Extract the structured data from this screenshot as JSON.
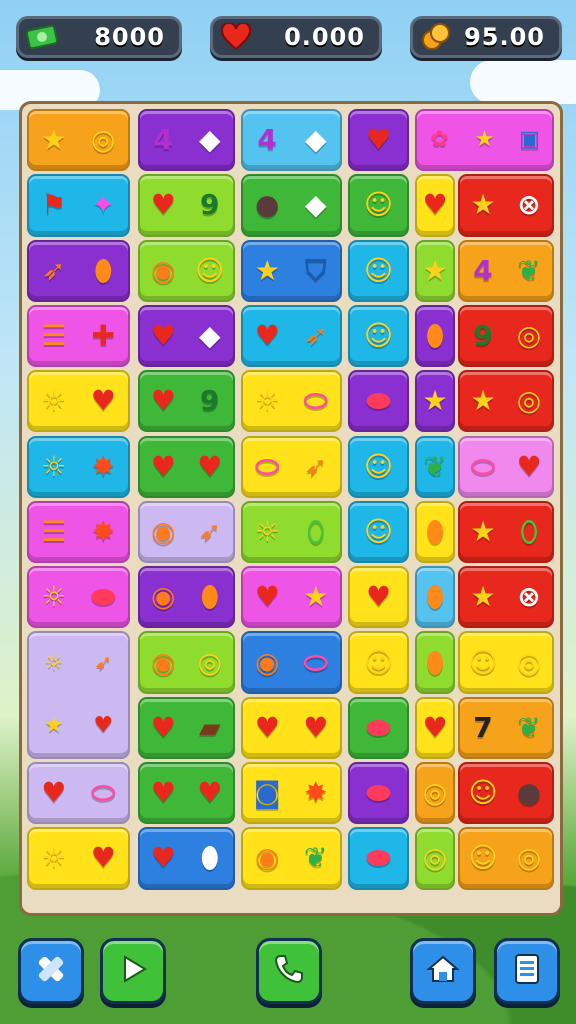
{
  "hud": {
    "cash": {
      "icon": "cash-icon",
      "value": "8000"
    },
    "lives": {
      "icon": "heart-icon",
      "value": "0.000"
    },
    "coins": {
      "icon": "coins-icon",
      "value": "95.00"
    }
  },
  "colors": {
    "orange": "#f7a21b",
    "purple": "#8a2fd0",
    "sky": "#55c3f0",
    "magenta": "#ee55e6",
    "cyan": "#1fb7e8",
    "lime": "#8fdc2f",
    "green": "#3fb83a",
    "yellow": "#ffe21a",
    "red": "#e8281c",
    "blue": "#2d7fe0",
    "lavender": "#cdb9f1",
    "pink": "#f088ee"
  },
  "tiles": [
    {
      "row": 0,
      "col": 0,
      "span": 1,
      "color": "orange",
      "icons": [
        "star-icon",
        "donut-icon"
      ]
    },
    {
      "row": 0,
      "col": 1,
      "span": 1,
      "color": "purple",
      "icons": [
        "number-four-icon",
        "diamond-icon"
      ]
    },
    {
      "row": 0,
      "col": 2,
      "span": 1,
      "color": "sky",
      "icons": [
        "number-four-icon",
        "diamond-icon"
      ]
    },
    {
      "row": 0,
      "col": 3,
      "span": 1,
      "color": "purple",
      "icons": [
        "heart-icon"
      ]
    },
    {
      "row": 0,
      "col": 4,
      "span": 1,
      "color": "magenta",
      "icons": [
        "strawberry-icon",
        "star-icon",
        "briefcase-icon"
      ]
    },
    {
      "row": 1,
      "col": 0,
      "span": 1,
      "color": "cyan",
      "icons": [
        "flag-icon",
        "sparkle-icon"
      ]
    },
    {
      "row": 1,
      "col": 1,
      "span": 1,
      "color": "lime",
      "icons": [
        "heart-icon",
        "number-nine-icon"
      ]
    },
    {
      "row": 1,
      "col": 2,
      "span": 1,
      "color": "green",
      "icons": [
        "bomb-icon",
        "diamond-icon"
      ]
    },
    {
      "row": 1,
      "col": 3,
      "span": 1,
      "color": "green",
      "icons": [
        "smiley-icon"
      ]
    },
    {
      "row": 1,
      "col": 4,
      "span": 1,
      "color": "yellow",
      "icons": [
        "heart-icon"
      ]
    },
    {
      "row": 1,
      "col": 5,
      "span": 1,
      "color": "red",
      "icons": [
        "star-icon",
        "racket-icon"
      ]
    },
    {
      "row": 2,
      "col": 0,
      "span": 1,
      "color": "purple",
      "icons": [
        "carrot-icon",
        "drop-icon"
      ]
    },
    {
      "row": 2,
      "col": 1,
      "span": 1,
      "color": "lime",
      "icons": [
        "lollipop-icon",
        "smiley-icon"
      ]
    },
    {
      "row": 2,
      "col": 2,
      "span": 1,
      "color": "blue",
      "icons": [
        "star-icon",
        "shield-icon"
      ]
    },
    {
      "row": 2,
      "col": 3,
      "span": 1,
      "color": "cyan",
      "icons": [
        "smiley-icon"
      ]
    },
    {
      "row": 2,
      "col": 4,
      "span": 1,
      "color": "lime",
      "icons": [
        "star-icon"
      ]
    },
    {
      "row": 2,
      "col": 5,
      "span": 1,
      "color": "orange",
      "icons": [
        "number-four-icon",
        "leaf-icon"
      ]
    },
    {
      "row": 3,
      "col": 0,
      "span": 1,
      "color": "magenta",
      "icons": [
        "burger-icon",
        "puzzle-icon"
      ]
    },
    {
      "row": 3,
      "col": 1,
      "span": 1,
      "color": "purple",
      "icons": [
        "heart-icon",
        "diamond-icon"
      ]
    },
    {
      "row": 3,
      "col": 2,
      "span": 1,
      "color": "cyan",
      "icons": [
        "heart-icon",
        "carrot-icon"
      ]
    },
    {
      "row": 3,
      "col": 3,
      "span": 1,
      "color": "cyan",
      "icons": [
        "smiley-icon"
      ]
    },
    {
      "row": 3,
      "col": 4,
      "span": 1,
      "color": "purple",
      "icons": [
        "drop-icon"
      ]
    },
    {
      "row": 3,
      "col": 5,
      "span": 1,
      "color": "red",
      "icons": [
        "number-nine-icon",
        "donut-icon"
      ]
    },
    {
      "row": 4,
      "col": 0,
      "span": 1,
      "color": "yellow",
      "icons": [
        "sun-icon",
        "heart-icon"
      ]
    },
    {
      "row": 4,
      "col": 1,
      "span": 1,
      "color": "green",
      "icons": [
        "heart-icon",
        "number-nine-icon"
      ]
    },
    {
      "row": 4,
      "col": 2,
      "span": 1,
      "color": "yellow",
      "icons": [
        "sun-icon",
        "candy-icon"
      ]
    },
    {
      "row": 4,
      "col": 3,
      "span": 1,
      "color": "purple",
      "icons": [
        "bean-icon"
      ]
    },
    {
      "row": 4,
      "col": 4,
      "span": 1,
      "color": "purple",
      "icons": [
        "star-icon"
      ]
    },
    {
      "row": 4,
      "col": 5,
      "span": 1,
      "color": "red",
      "icons": [
        "star-icon",
        "donut-icon"
      ]
    },
    {
      "row": 5,
      "col": 0,
      "span": 1,
      "color": "cyan",
      "icons": [
        "sun-icon",
        "splat-icon"
      ]
    },
    {
      "row": 5,
      "col": 1,
      "span": 1,
      "color": "green",
      "icons": [
        "heart-icon",
        "heart-icon"
      ]
    },
    {
      "row": 5,
      "col": 2,
      "span": 1,
      "color": "yellow",
      "icons": [
        "candy-icon",
        "carrot-icon"
      ]
    },
    {
      "row": 5,
      "col": 3,
      "span": 1,
      "color": "cyan",
      "icons": [
        "smiley-icon"
      ]
    },
    {
      "row": 5,
      "col": 4,
      "span": 1,
      "color": "cyan",
      "icons": [
        "leaf-icon"
      ]
    },
    {
      "row": 5,
      "col": 5,
      "span": 1,
      "color": "pink",
      "icons": [
        "candy-icon",
        "heart-icon"
      ]
    },
    {
      "row": 6,
      "col": 0,
      "span": 1,
      "color": "magenta",
      "icons": [
        "burger-icon",
        "splat-icon"
      ]
    },
    {
      "row": 6,
      "col": 1,
      "span": 1,
      "color": "lavender",
      "icons": [
        "lollipop-icon",
        "carrot-icon"
      ]
    },
    {
      "row": 6,
      "col": 2,
      "span": 1,
      "color": "lime",
      "icons": [
        "sun-icon",
        "pickle-icon"
      ]
    },
    {
      "row": 6,
      "col": 3,
      "span": 1,
      "color": "cyan",
      "icons": [
        "smiley-icon"
      ]
    },
    {
      "row": 6,
      "col": 4,
      "span": 1,
      "color": "yellow",
      "icons": [
        "drop-icon"
      ]
    },
    {
      "row": 6,
      "col": 5,
      "span": 1,
      "color": "red",
      "icons": [
        "star-icon",
        "pickle-icon"
      ]
    },
    {
      "row": 7,
      "col": 0,
      "span": 1,
      "color": "magenta",
      "icons": [
        "sun-icon",
        "bean-icon"
      ]
    },
    {
      "row": 7,
      "col": 1,
      "span": 1,
      "color": "purple",
      "icons": [
        "lollipop-icon",
        "drop-icon"
      ]
    },
    {
      "row": 7,
      "col": 2,
      "span": 1,
      "color": "magenta",
      "icons": [
        "heart-icon",
        "star-icon"
      ]
    },
    {
      "row": 7,
      "col": 3,
      "span": 1,
      "color": "yellow",
      "icons": [
        "heart-icon"
      ]
    },
    {
      "row": 7,
      "col": 4,
      "span": 1,
      "color": "sky",
      "icons": [
        "drop-icon"
      ]
    },
    {
      "row": 7,
      "col": 5,
      "span": 1,
      "color": "red",
      "icons": [
        "star-icon",
        "racket-icon"
      ]
    },
    {
      "row": 8,
      "col": 0,
      "span": 2,
      "color": "lavender",
      "icons": [
        "sun-icon",
        "carrot-icon",
        "star-icon",
        "heart-icon"
      ]
    },
    {
      "row": 8,
      "col": 1,
      "span": 1,
      "color": "lime",
      "icons": [
        "lollipop-icon",
        "donut-icon"
      ]
    },
    {
      "row": 8,
      "col": 2,
      "span": 1,
      "color": "blue",
      "icons": [
        "lollipop-icon",
        "candy-icon"
      ]
    },
    {
      "row": 8,
      "col": 3,
      "span": 1,
      "color": "yellow",
      "icons": [
        "smiley-icon"
      ]
    },
    {
      "row": 8,
      "col": 4,
      "span": 1,
      "color": "lime",
      "icons": [
        "drop-icon"
      ]
    },
    {
      "row": 8,
      "col": 5,
      "span": 1,
      "color": "yellow",
      "icons": [
        "smiley-icon",
        "donut-icon"
      ]
    },
    {
      "row": 9,
      "col": 1,
      "span": 1,
      "color": "green",
      "icons": [
        "heart-icon",
        "chocolate-icon"
      ]
    },
    {
      "row": 9,
      "col": 2,
      "span": 1,
      "color": "yellow",
      "icons": [
        "heart-icon",
        "heart-icon"
      ]
    },
    {
      "row": 9,
      "col": 3,
      "span": 1,
      "color": "green",
      "icons": [
        "bean-icon"
      ]
    },
    {
      "row": 9,
      "col": 4,
      "span": 1,
      "color": "yellow",
      "icons": [
        "heart-icon"
      ]
    },
    {
      "row": 9,
      "col": 5,
      "span": 1,
      "color": "orange",
      "icons": [
        "number-seven-icon",
        "leaf-icon"
      ]
    },
    {
      "row": 10,
      "col": 0,
      "span": 1,
      "color": "lavender",
      "icons": [
        "heart-icon",
        "candy-icon"
      ]
    },
    {
      "row": 10,
      "col": 1,
      "span": 1,
      "color": "green",
      "icons": [
        "heart-icon",
        "heart-icon"
      ]
    },
    {
      "row": 10,
      "col": 2,
      "span": 1,
      "color": "yellow",
      "icons": [
        "jar-icon",
        "splat-icon"
      ]
    },
    {
      "row": 10,
      "col": 3,
      "span": 1,
      "color": "purple",
      "icons": [
        "bean-icon"
      ]
    },
    {
      "row": 10,
      "col": 4,
      "span": 1,
      "color": "orange",
      "icons": [
        "donut-icon"
      ]
    },
    {
      "row": 10,
      "col": 5,
      "span": 1,
      "color": "red",
      "icons": [
        "smiley-icon",
        "bomb-icon"
      ]
    },
    {
      "row": 11,
      "col": 0,
      "span": 1,
      "color": "yellow",
      "icons": [
        "sun-icon",
        "heart-icon"
      ]
    },
    {
      "row": 11,
      "col": 1,
      "span": 1,
      "color": "blue",
      "icons": [
        "heart-icon",
        "egg-icon"
      ]
    },
    {
      "row": 11,
      "col": 2,
      "span": 1,
      "color": "yellow",
      "icons": [
        "lollipop-icon",
        "leaf-icon"
      ]
    },
    {
      "row": 11,
      "col": 3,
      "span": 1,
      "color": "cyan",
      "icons": [
        "bean-icon"
      ]
    },
    {
      "row": 11,
      "col": 4,
      "span": 1,
      "color": "lime",
      "icons": [
        "donut-icon"
      ]
    },
    {
      "row": 11,
      "col": 5,
      "span": 1,
      "color": "orange",
      "icons": [
        "smiley-icon",
        "donut-icon"
      ]
    }
  ],
  "bottom_bar": {
    "buttons": [
      {
        "name": "shuffle-button",
        "icon": "shuffle-icon",
        "color": "#2d8fe8"
      },
      {
        "name": "play-button",
        "icon": "play-icon",
        "color": "#3fc23a"
      },
      {
        "name": "call-button",
        "icon": "phone-icon",
        "color": "#3fc23a"
      },
      {
        "name": "home-button",
        "icon": "home-icon",
        "color": "#2d8fe8"
      },
      {
        "name": "menu-button",
        "icon": "menu-icon",
        "color": "#2d8fe8"
      }
    ]
  }
}
